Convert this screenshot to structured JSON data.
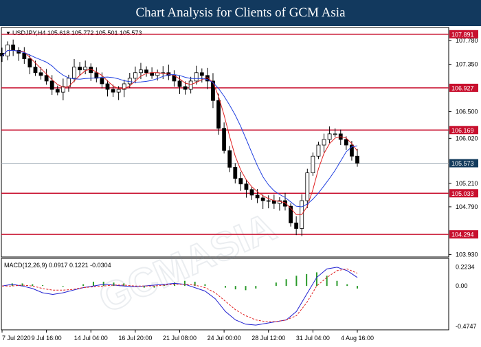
{
  "header": {
    "title": "Chart Analysis for Clients of GCM Asia"
  },
  "chart_data": [
    {
      "type": "candlestick",
      "symbol_info": "USDJPY,H4  105.618 105.772 105.501 105.573",
      "current_price": "105.573",
      "y_ticks": [
        "107.780",
        "107.350",
        "106.500",
        "106.020",
        "105.210",
        "104.790",
        "103.930"
      ],
      "ylim": [
        103.9,
        108.0
      ],
      "support_resistance": [
        {
          "value": 107.891,
          "label": "107.891"
        },
        {
          "value": 106.927,
          "label": "106.927"
        },
        {
          "value": 106.169,
          "label": "106.169"
        },
        {
          "value": 105.033,
          "label": "105.033"
        },
        {
          "value": 104.294,
          "label": "104.294"
        }
      ],
      "x_labels": [
        "7 Jul 2020",
        "9 Jul 16:00",
        "14 Jul 04:00",
        "16 Jul 20:00",
        "21 Jul 08:00",
        "24 Jul 00:00",
        "28 Jul 12:00",
        "31 Jul 04:00",
        "4 Aug 16:00"
      ],
      "close_path": [
        107.5,
        107.7,
        107.6,
        107.55,
        107.45,
        107.3,
        107.2,
        107.15,
        107.05,
        106.9,
        106.85,
        106.95,
        107.1,
        107.3,
        107.25,
        107.3,
        107.2,
        107.1,
        107.0,
        106.9,
        106.85,
        106.9,
        107.0,
        107.1,
        107.2,
        107.25,
        107.2,
        107.15,
        107.2,
        107.2,
        107.15,
        107.05,
        106.95,
        106.9,
        107.05,
        107.2,
        107.15,
        107.05,
        106.7,
        106.2,
        105.8,
        105.5,
        105.3,
        105.2,
        105.1,
        105.0,
        104.95,
        104.9,
        104.9,
        104.85,
        104.9,
        104.8,
        104.5,
        104.4,
        104.9,
        105.4,
        105.7,
        105.9,
        106.0,
        106.1,
        106.1,
        106.0,
        105.9,
        105.7,
        105.573
      ],
      "macd": {
        "label": "MACD(12,26,9) 0.0917 0.1221 -0.0304",
        "y_ticks": [
          "0.2234",
          "0.00",
          "-0.4747"
        ],
        "ylim": [
          -0.5,
          0.26
        ],
        "macd_values": [
          0.0,
          0.02,
          0.0,
          -0.03,
          -0.08,
          -0.1,
          -0.08,
          -0.05,
          -0.02,
          0.0,
          0.02,
          0.01,
          0.0,
          -0.01,
          0.0,
          0.01,
          0.02,
          0.03,
          0.02,
          -0.02,
          -0.06,
          -0.15,
          -0.3,
          -0.4,
          -0.45,
          -0.46,
          -0.44,
          -0.42,
          -0.4,
          -0.3,
          -0.1,
          0.1,
          0.2,
          0.22,
          0.18,
          0.1
        ],
        "signal_values": [
          0.0,
          0.0,
          0.01,
          0.0,
          -0.03,
          -0.05,
          -0.05,
          -0.04,
          -0.02,
          -0.01,
          0.0,
          0.01,
          0.01,
          0.0,
          0.0,
          0.0,
          0.01,
          0.02,
          0.02,
          0.01,
          -0.02,
          -0.08,
          -0.18,
          -0.28,
          -0.35,
          -0.4,
          -0.42,
          -0.42,
          -0.4,
          -0.35,
          -0.2,
          0.0,
          0.1,
          0.18,
          0.2,
          0.15
        ],
        "hist_values": [
          0.0,
          0.03,
          0.03,
          0.02,
          0.01,
          0.0,
          -0.01,
          0.0,
          0.02,
          0.05,
          0.05,
          0.04,
          0.03,
          0.0,
          -0.02,
          -0.02,
          0.01,
          0.04,
          0.06,
          0.05,
          0.02,
          0.0,
          -0.02,
          -0.04,
          -0.05,
          -0.03,
          0.0,
          0.04,
          0.08,
          0.12,
          0.14,
          0.16,
          0.12,
          0.06,
          0.02,
          -0.03
        ]
      }
    }
  ],
  "colors": {
    "title_bg": "#12395e",
    "sr_line": "#c8102e",
    "ma_red": "#e02020",
    "ma_blue": "#2040e0",
    "macd_green": "#2a9a2a",
    "signal_red": "#e02020",
    "macd_blue": "#1f1fd0",
    "current_price_bg": "#123a5c"
  }
}
